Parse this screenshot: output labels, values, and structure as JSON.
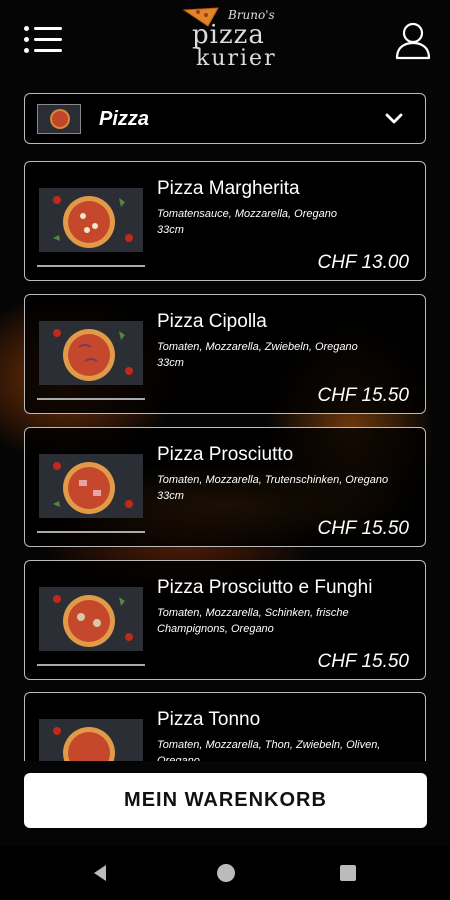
{
  "header": {
    "logo_line1": "Bruno's",
    "logo_line2": "pizza",
    "logo_line3": "kurier",
    "menu_icon": "hamburger-menu-icon",
    "account_icon": "user-icon"
  },
  "category": {
    "selected": "Pizza",
    "icon": "chevron-down-icon"
  },
  "products": [
    {
      "name": "Pizza Margherita",
      "description": "Tomatensauce, Mozzarella, Oregano\n33cm",
      "price": "CHF 13.00"
    },
    {
      "name": "Pizza Cipolla",
      "description": "Tomaten, Mozzarella, Zwiebeln, Oregano\n33cm",
      "price": "CHF 15.50"
    },
    {
      "name": "Pizza Prosciutto",
      "description": "Tomaten, Mozzarella, Trutenschinken, Oregano\n33cm",
      "price": "CHF 15.50"
    },
    {
      "name": "Pizza Prosciutto e Funghi",
      "description": "Tomaten, Mozzarella, Schinken, frische Champignons, Oregano",
      "price": "CHF 15.50"
    },
    {
      "name": "Pizza Tonno",
      "description": "Tomaten, Mozzarella, Thon, Zwiebeln, Oliven, Oregano",
      "price": ""
    }
  ],
  "cart": {
    "label": "MEIN WARENKORB"
  },
  "colors": {
    "background": "#000000",
    "card_border": "#bbbbbb",
    "button_bg": "#ffffff",
    "fire": "#f07814"
  }
}
